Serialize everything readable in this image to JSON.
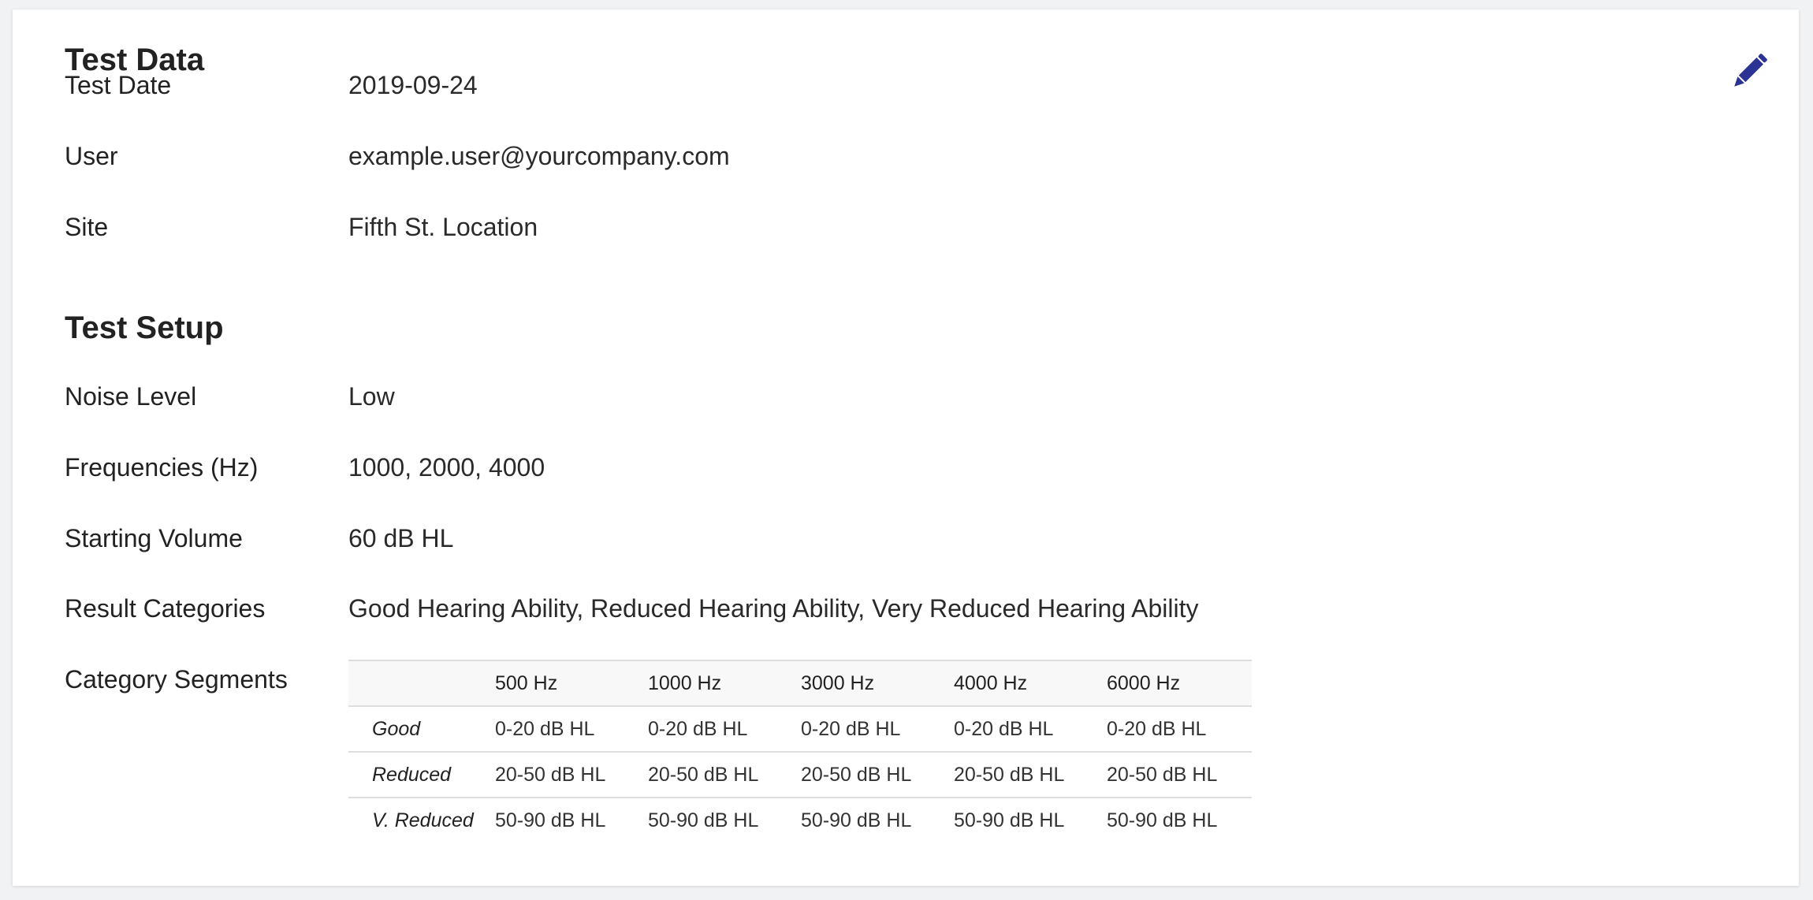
{
  "colors": {
    "accent": "#2b3494",
    "card_bg": "#ffffff",
    "page_bg": "#f1f2f4",
    "divider": "#dedede"
  },
  "edit_icon": "pencil-icon",
  "test_data": {
    "title": "Test Data",
    "test_date_label": "Test Date",
    "test_date_value": "2019-09-24",
    "user_label": "User",
    "user_value": "example.user@yourcompany.com",
    "site_label": "Site",
    "site_value": "Fifth St. Location"
  },
  "test_setup": {
    "title": "Test Setup",
    "noise_label": "Noise Level",
    "noise_value": "Low",
    "freq_label": "Frequencies (Hz)",
    "freq_value": "1000, 2000, 4000",
    "volume_label": "Starting Volume",
    "volume_value": "60 dB HL",
    "categories_label": "Result Categories",
    "categories_value": "Good Hearing Ability, Reduced Hearing Ability, Very Reduced Hearing Ability",
    "segments_label": "Category Segments"
  },
  "segments_table": {
    "columns": [
      "",
      "500 Hz",
      "1000 Hz",
      "3000 Hz",
      "4000 Hz",
      "6000 Hz"
    ],
    "rows": [
      {
        "label": "Good",
        "cells": [
          "0-20 dB HL",
          "0-20 dB HL",
          "0-20 dB HL",
          "0-20 dB HL",
          "0-20 dB HL"
        ]
      },
      {
        "label": "Reduced",
        "cells": [
          "20-50 dB HL",
          "20-50 dB HL",
          "20-50 dB HL",
          "20-50 dB HL",
          "20-50 dB HL"
        ]
      },
      {
        "label": "V. Reduced",
        "cells": [
          "50-90 dB HL",
          "50-90 dB HL",
          "50-90 dB HL",
          "50-90 dB HL",
          "50-90 dB HL"
        ]
      }
    ]
  }
}
